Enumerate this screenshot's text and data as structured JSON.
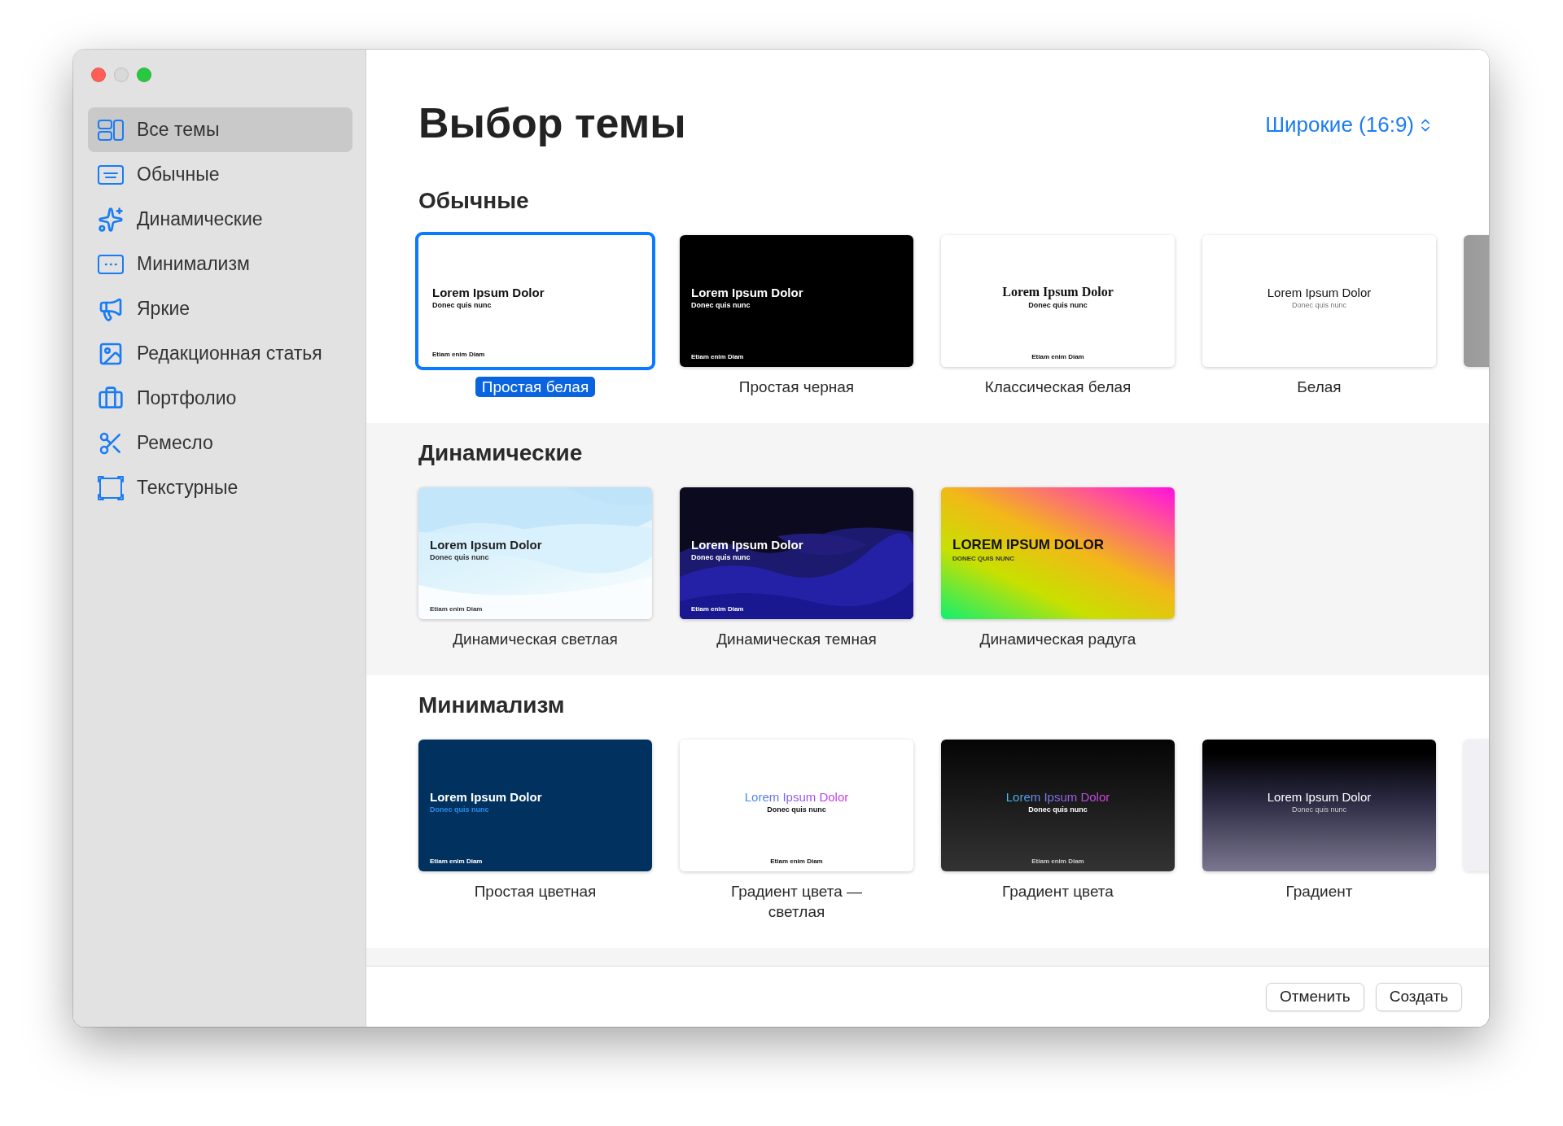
{
  "sidebar": {
    "items": [
      {
        "label": "Все темы",
        "selected": true
      },
      {
        "label": "Обычные",
        "selected": false
      },
      {
        "label": "Динамические",
        "selected": false
      },
      {
        "label": "Минимализм",
        "selected": false
      },
      {
        "label": "Яркие",
        "selected": false
      },
      {
        "label": "Редакционная статья",
        "selected": false
      },
      {
        "label": "Портфолио",
        "selected": false
      },
      {
        "label": "Ремесло",
        "selected": false
      },
      {
        "label": "Текстурные",
        "selected": false
      }
    ]
  },
  "title": "Выбор темы",
  "aspect_menu": {
    "label": "Широкие (16:9)"
  },
  "sections": [
    {
      "heading": "Обычные",
      "peek": {
        "kind": "gray"
      },
      "themes": [
        {
          "name": "Простая белая",
          "selected": true,
          "kind": "plain_white",
          "slide_title": "Lorem Ipsum Dolor",
          "slide_subtitle": "Donec quis nunc",
          "slide_footer": "Etiam enim Diam"
        },
        {
          "name": "Простая черная",
          "selected": false,
          "kind": "plain_black",
          "slide_title": "Lorem Ipsum Dolor",
          "slide_subtitle": "Donec quis nunc",
          "slide_footer": "Etiam enim Diam"
        },
        {
          "name": "Классическая белая",
          "selected": false,
          "kind": "classic_white",
          "slide_title": "Lorem Ipsum Dolor",
          "slide_subtitle": "Donec quis nunc",
          "slide_footer": "Etiam enim Diam"
        },
        {
          "name": "Белая",
          "selected": false,
          "kind": "white",
          "slide_title": "Lorem Ipsum Dolor",
          "slide_subtitle": "Donec quis nunc"
        }
      ]
    },
    {
      "heading": "Динамические",
      "themes": [
        {
          "name": "Динамическая светлая",
          "selected": false,
          "kind": "dynamic_light",
          "slide_title": "Lorem Ipsum Dolor",
          "slide_subtitle": "Donec quis nunc",
          "slide_footer": "Etiam enim Diam"
        },
        {
          "name": "Динамическая темная",
          "selected": false,
          "kind": "dynamic_dark",
          "slide_title": "Lorem Ipsum Dolor",
          "slide_subtitle": "Donec quis nunc",
          "slide_footer": "Etiam enim Diam"
        },
        {
          "name": "Динамическая радуга",
          "selected": false,
          "kind": "dynamic_rainbow",
          "slide_title": "LOREM IPSUM DOLOR",
          "slide_subtitle": "DONEC QUIS NUNC"
        }
      ]
    },
    {
      "heading": "Минимализм",
      "peek": {
        "kind": "light"
      },
      "themes": [
        {
          "name": "Простая цветная",
          "selected": false,
          "kind": "plain_color",
          "slide_title": "Lorem Ipsum Dolor",
          "slide_subtitle": "Donec quis nunc",
          "slide_footer": "Etiam enim Diam"
        },
        {
          "name": "Градиент цвета — светлая",
          "selected": false,
          "kind": "gradient_light",
          "slide_title": "Lorem Ipsum Dolor",
          "slide_subtitle": "Donec quis nunc",
          "slide_footer": "Etiam enim Diam"
        },
        {
          "name": "Градиент цвета",
          "selected": false,
          "kind": "gradient_dark",
          "slide_title": "Lorem Ipsum Dolor",
          "slide_subtitle": "Donec quis nunc",
          "slide_footer": "Etiam enim Diam"
        },
        {
          "name": "Градиент",
          "selected": false,
          "kind": "gradient",
          "slide_title": "Lorem Ipsum Dolor",
          "slide_subtitle": "Donec quis nunc"
        }
      ]
    }
  ],
  "buttons": [
    {
      "label": "Отменить"
    },
    {
      "label": "Создать"
    }
  ]
}
